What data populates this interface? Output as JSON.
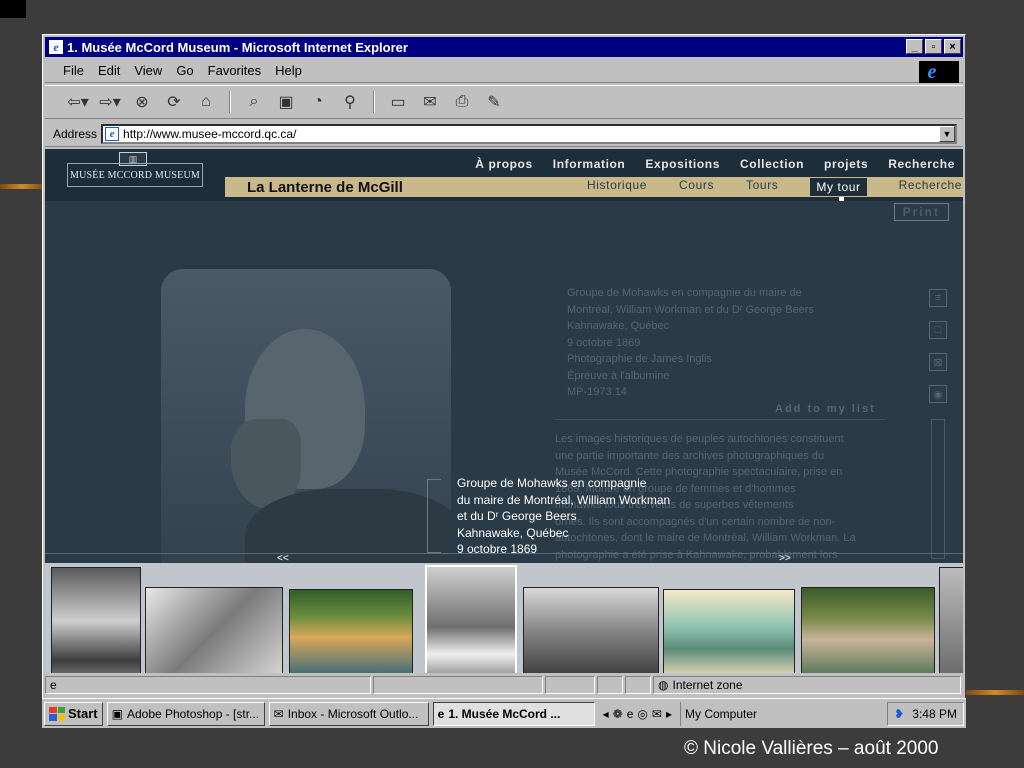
{
  "browser": {
    "title": "1. Musée McCord Museum - Microsoft Internet Explorer",
    "menu": [
      "File",
      "Edit",
      "View",
      "Go",
      "Favorites",
      "Help"
    ],
    "address_label": "Address",
    "url": "http://www.musee-mccord.qc.ca/",
    "toolbar_icons": [
      "back-icon",
      "forward-icon",
      "stop-icon",
      "refresh-icon",
      "home-icon",
      "search-icon",
      "favorites-icon",
      "history-icon",
      "channels-icon",
      "fullscreen-icon",
      "mail-icon",
      "print-icon",
      "edit-icon"
    ]
  },
  "site": {
    "logo": "MUSÉE MCCORD MUSEUM",
    "topnav": [
      "À propos",
      "Information",
      "Expositions",
      "Collection",
      "projets",
      "Recherche"
    ],
    "section_title": "La Lanterne de McGill",
    "subnav": [
      "Historique",
      "Cours",
      "Tours",
      "My tour",
      "Recherche"
    ],
    "active_subnav": "My tour",
    "print_label": "Print",
    "caption_lines": [
      "Groupe de Mohawks en compagnie du maire de",
      "Montréal, William Workman et du Dʳ George Beers",
      "Kahnawake, Québec",
      "9 octobre 1869",
      "Photographie de James Inglis",
      "Épreuve à l'albumine",
      "MP-1973.14"
    ],
    "add_to_list": "Add to my list",
    "description_lines": [
      "Les images historiques de peuples autochtones constituent",
      "une partie importante des archives photographiques du",
      "Musée McCord. Cette photographie spectaculaire, prise en",
      "1869, montre un groupe de femmes et d'hommes",
      "mohawks tous très vêtus de superbes vêtements",
      "ornés. Ils sont accompagnés d'un certain nombre de non-",
      "autochtones, dont le maire de Montréal, William Workman. La",
      "photographie a été prise à Kahnawake, probablement lors"
    ],
    "tooltip_lines": [
      "Groupe de Mohawks en compagnie",
      "du maire de  Montréal, William Workman",
      "et du Dʳ George Beers",
      "Kahnawake, Québec",
      "9 octobre 1869"
    ],
    "pager_prev": "<<",
    "pager_next": ">>"
  },
  "statusbar": {
    "zone": "Internet zone"
  },
  "taskbar": {
    "start": "Start",
    "tasks": [
      "Adobe Photoshop - [str...",
      "Inbox - Microsoft Outlo...",
      "1. Musée McCord ..."
    ],
    "active_task": "1. Musée McCord ...",
    "my_computer": "My Computer",
    "clock": "3:48 PM"
  },
  "slide": {
    "credit": "© Nicole Vallières – août 2000"
  }
}
